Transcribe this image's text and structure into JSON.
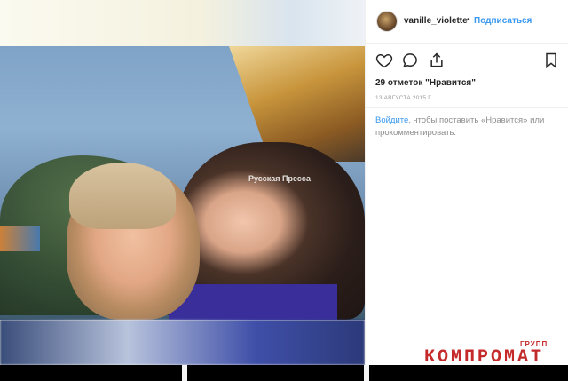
{
  "post": {
    "username": "vanille_violette",
    "separator": "•",
    "follow_label": "Подписаться",
    "likes_text": "29 отметок \"Нравится\"",
    "date_text": "13 АВГУСТА 2015 Г.",
    "login_link": "Войдите",
    "login_rest": ", чтобы поставить «Нравится» или прокомментировать."
  },
  "photo": {
    "watermark": "Русская Пресса"
  },
  "overlay": {
    "brand_main": "КОМПРОМАТ",
    "brand_small": "ГРУПП"
  },
  "icons": {
    "like": "heart-icon",
    "comment": "comment-icon",
    "share": "share-icon",
    "save": "bookmark-icon"
  },
  "colors": {
    "link_blue": "#3897f0",
    "text_dark": "#262626",
    "text_gray": "#8e8e8e",
    "brand_red": "#c52a2a"
  }
}
